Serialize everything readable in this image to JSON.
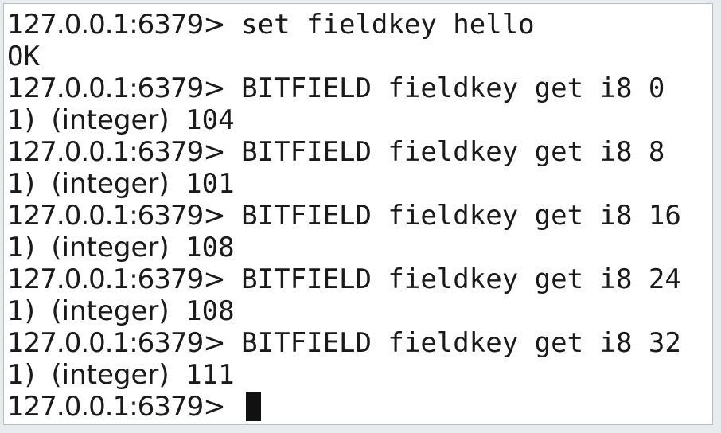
{
  "terminal": {
    "prompt": "127.0.0.1:6379>",
    "lines": [
      {
        "kind": "cmd",
        "text": "set fieldkey hello"
      },
      {
        "kind": "out",
        "text": "OK"
      },
      {
        "kind": "cmd",
        "text": "BITFIELD fieldkey get i8 0"
      },
      {
        "kind": "res",
        "index": "1)",
        "type": "(integer)",
        "value": "104"
      },
      {
        "kind": "cmd",
        "text": "BITFIELD fieldkey get i8 8"
      },
      {
        "kind": "res",
        "index": "1)",
        "type": "(integer)",
        "value": "101"
      },
      {
        "kind": "cmd",
        "text": "BITFIELD fieldkey get i8 16"
      },
      {
        "kind": "res",
        "index": "1)",
        "type": "(integer)",
        "value": "108"
      },
      {
        "kind": "cmd",
        "text": "BITFIELD fieldkey get i8 24"
      },
      {
        "kind": "res",
        "index": "1)",
        "type": "(integer)",
        "value": "108"
      },
      {
        "kind": "cmd",
        "text": "BITFIELD fieldkey get i8 32"
      },
      {
        "kind": "res",
        "index": "1)",
        "type": "(integer)",
        "value": "111"
      }
    ],
    "cursor_color": "#111111"
  }
}
